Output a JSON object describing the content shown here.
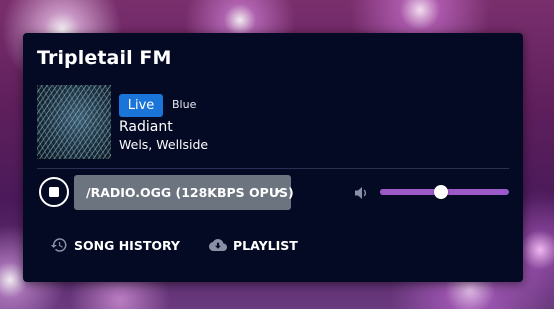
{
  "player": {
    "station_name": "Tripletail FM",
    "live_label": "Live",
    "stream_name": "Blue",
    "song_title": "Radiant",
    "song_artist": "Wels, Wellside",
    "stream_select": "/RADIO.OGG (128KBPS OPUS)",
    "volume_level": 0.47,
    "song_history_label": "SONG HISTORY",
    "playlist_label": "PLAYLIST"
  },
  "icons": {
    "stop": "stop-icon",
    "dropdown": "chevron-down-icon",
    "volume": "volume-icon",
    "history": "history-icon",
    "playlist": "cloud-download-icon"
  },
  "colors": {
    "card_background": "#040a24",
    "live_badge": "#1b75d8",
    "select_background": "#6c7480",
    "volume_accent": "#9b5ac8"
  }
}
